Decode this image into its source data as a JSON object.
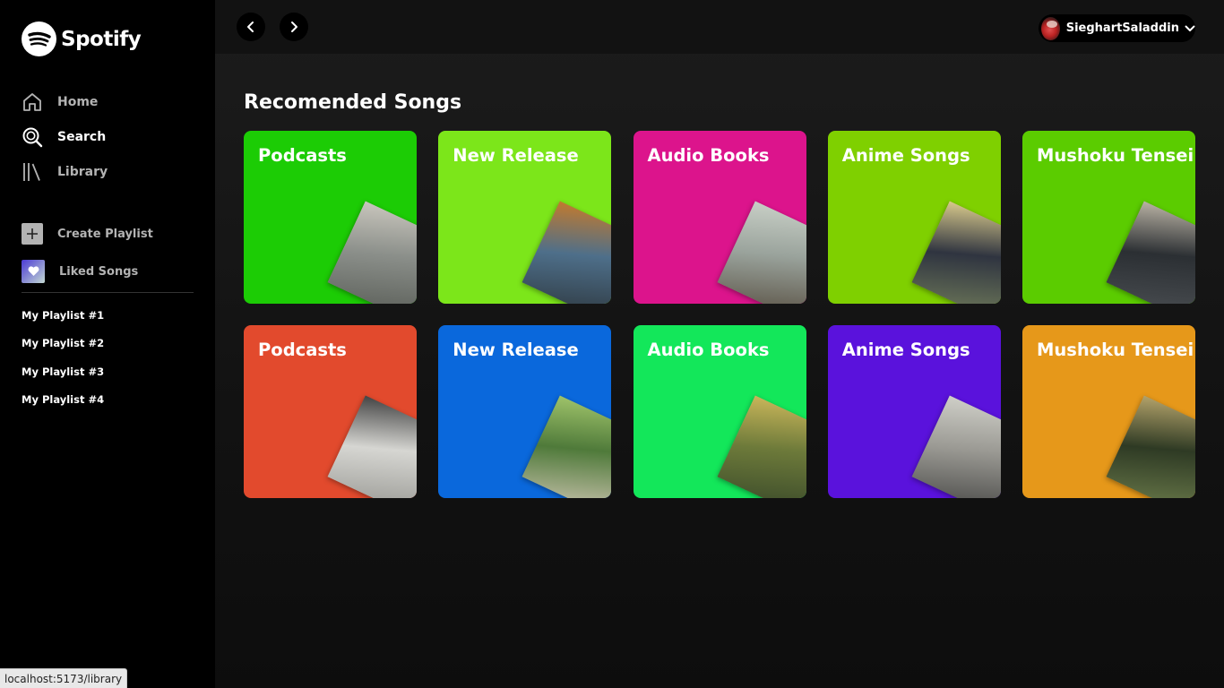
{
  "app": {
    "logo_text": "Spotify"
  },
  "sidebar": {
    "nav": [
      {
        "label": "Home",
        "icon": "home-icon",
        "active": false
      },
      {
        "label": "Search",
        "icon": "search-icon",
        "active": true
      },
      {
        "label": "Library",
        "icon": "library-icon",
        "active": false
      }
    ],
    "actions": [
      {
        "label": "Create Playlist",
        "icon": "plus-icon"
      },
      {
        "label": "Liked Songs",
        "icon": "heart-icon"
      }
    ],
    "playlists": [
      "My Playlist #1",
      "My Playlist #2",
      "My Playlist #3",
      "My Playlist #4"
    ]
  },
  "header": {
    "username": "SieghartSaladdin"
  },
  "main": {
    "section_title": "Recomended Songs",
    "cards": [
      {
        "title": "Podcasts",
        "color": "#1ccc05",
        "art": [
          "#8b8f8a",
          "#c9c6bd",
          "#5a5e58"
        ]
      },
      {
        "title": "New Release",
        "color": "#7ce61a",
        "art": [
          "#4e6f8a",
          "#c27a2e",
          "#2f3a42"
        ]
      },
      {
        "title": "Audio Books",
        "color": "#dc148c",
        "art": [
          "#9aa39c",
          "#c8cfc6",
          "#5a5245"
        ]
      },
      {
        "title": "Anime Songs",
        "color": "#7fd000",
        "art": [
          "#2f3440",
          "#d8c98c",
          "#6f7a5a"
        ]
      },
      {
        "title": "Mushoku Tensei",
        "color": "#5bcc00",
        "art": [
          "#2b2f33",
          "#b9b2a4",
          "#4a4e52"
        ]
      },
      {
        "title": "Podcasts",
        "color": "#e24a2d",
        "art": [
          "#d6d6d2",
          "#444",
          "#9a9a95"
        ]
      },
      {
        "title": "New Release",
        "color": "#0a68dc",
        "art": [
          "#4f7a3a",
          "#9fc36a",
          "#c9c2ad"
        ]
      },
      {
        "title": "Audio Books",
        "color": "#13e75a",
        "art": [
          "#6d7a3a",
          "#c9b65a",
          "#3a4a2a"
        ]
      },
      {
        "title": "Anime Songs",
        "color": "#5a12dc",
        "art": [
          "#9b9a94",
          "#cfcfc8",
          "#4a4a48"
        ]
      },
      {
        "title": "Mushoku Tensei",
        "color": "#e6981a",
        "art": [
          "#2e3a24",
          "#b3a26a",
          "#6a7a4a"
        ]
      }
    ]
  },
  "status_bar": {
    "url": "localhost:5173/library"
  }
}
